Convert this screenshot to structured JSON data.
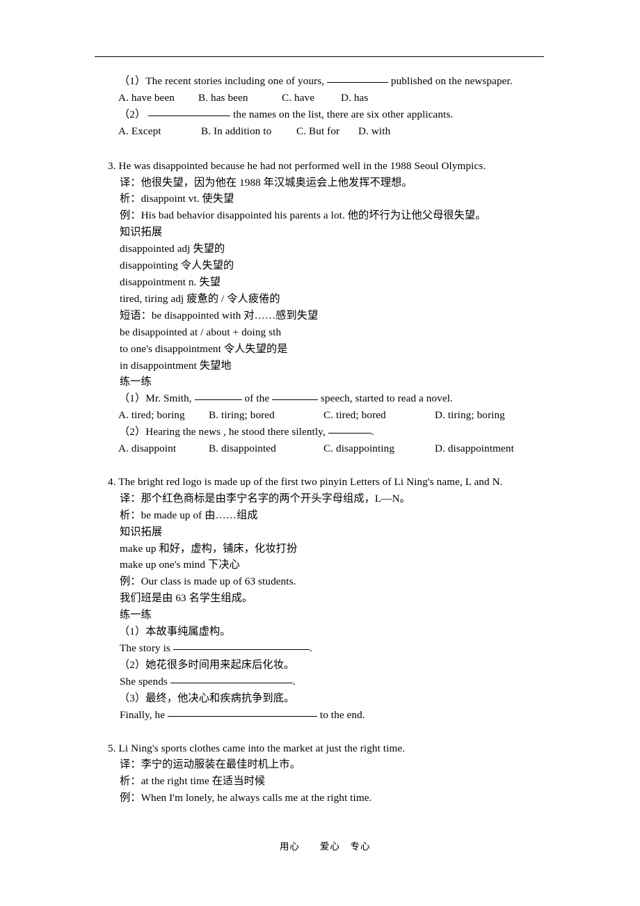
{
  "document": {
    "footer": {
      "item1": "用心",
      "item2": "爱心",
      "item3": "专心"
    }
  },
  "carryover_exercise": {
    "q1": {
      "stem_pre": "（1）The recent stories including one of yours,",
      "stem_post": "published on the newspaper.",
      "options": [
        "A. have been",
        "B. has been",
        "C. have",
        "D. has"
      ]
    },
    "q2": {
      "stem_pre": "（2）",
      "stem_post": "the names on the list, there are six other applicants.",
      "options": [
        "A. Except",
        "B. In addition to",
        "C. But for",
        "D. with"
      ]
    }
  },
  "item3": {
    "number": "3.",
    "sentence": "He was disappointed because he had not performed well in the 1988 Seoul Olympics.",
    "translation": "译：他很失望，因为他在 1988 年汉城奥运会上他发挥不理想。",
    "analysis": "析：disappoint vt. 使失望",
    "example": "例：His bad behavior disappointed his parents a lot. 他的坏行为让他父母很失望。",
    "expansion_heading": "知识拓展",
    "expansion_lines": [
      "disappointed adj 失望的",
      "disappointing 令人失望的",
      "disappointment n. 失望",
      "tired, tiring adj 疲惫的 / 令人疲倦的",
      "短语：be disappointed with 对……感到失望",
      "be disappointed at / about + doing sth",
      "to one's disappointment 令人失望的是",
      "in disappointment 失望地"
    ],
    "practice_heading": "练一练",
    "practice": {
      "q1": {
        "stem_pre": "（1）Mr. Smith,",
        "stem_mid": "of the",
        "stem_post": "speech, started to read a novel.",
        "options": [
          "A. tired; boring",
          "B. tiring; bored",
          "C. tired; bored",
          "D. tiring; boring"
        ]
      },
      "q2": {
        "stem_pre": "（2）Hearing the news , he stood there silently,",
        "stem_post": ".",
        "options": [
          "A. disappoint",
          "B. disappointed",
          "C. disappointing",
          "D. disappointment"
        ]
      }
    }
  },
  "item4": {
    "number": "4.",
    "sentence": "The bright red logo is made up of the first two pinyin Letters of Li Ning's name, L and N.",
    "translation": "译：那个红色商标是由李宁名字的两个开头字母组成，L—N。",
    "analysis": "析：be made up of 由……组成",
    "expansion_heading": "知识拓展",
    "expansion_lines": [
      "make up 和好，虚构，铺床，化妆打扮",
      "make up one's mind 下决心"
    ],
    "example": "例：Our class is made up of 63 students.",
    "example_translation": "我们班是由 63 名学生组成。",
    "practice_heading": "练一练",
    "practice": {
      "q1": {
        "prompt": "（1）本故事纯属虚构。",
        "answer_pre": "The story is",
        "answer_post": "."
      },
      "q2": {
        "prompt": "（2）她花很多时间用来起床后化妆。",
        "answer_pre": "She spends",
        "answer_post": "."
      },
      "q3": {
        "prompt": "（3）最终，他决心和疾病抗争到底。",
        "answer_pre": "Finally, he",
        "answer_post": "to the end."
      }
    }
  },
  "item5": {
    "number": "5.",
    "sentence": "Li Ning's sports clothes came into the market at just the right time.",
    "translation": "译：李宁的运动服装在最佳时机上市。",
    "analysis": "析：at the right time 在适当时候",
    "example": "例：When I'm lonely, he always calls me at the right time."
  }
}
